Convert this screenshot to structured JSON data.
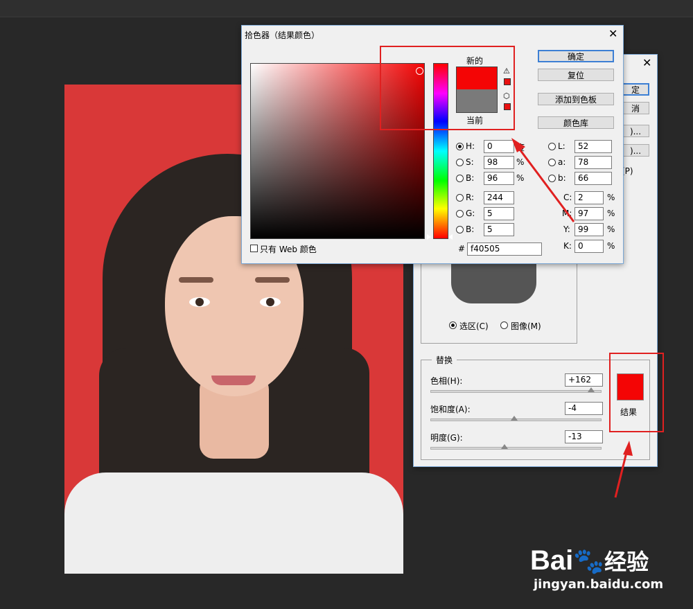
{
  "picker": {
    "title": "拾色器（结果颜色）",
    "new_label": "新的",
    "current_label": "当前",
    "buttons": {
      "ok": "确定",
      "reset": "复位",
      "add_swatch": "添加到色板",
      "libraries": "颜色库"
    },
    "hsb": {
      "h": {
        "label": "H:",
        "value": "0",
        "unit": "度"
      },
      "s": {
        "label": "S:",
        "value": "98",
        "unit": "%"
      },
      "b": {
        "label": "B:",
        "value": "96",
        "unit": "%"
      }
    },
    "rgb": {
      "r": {
        "label": "R:",
        "value": "244"
      },
      "g": {
        "label": "G:",
        "value": "5"
      },
      "b": {
        "label": "B:",
        "value": "5"
      }
    },
    "lab": {
      "l": {
        "label": "L:",
        "value": "52"
      },
      "a": {
        "label": "a:",
        "value": "78"
      },
      "b": {
        "label": "b:",
        "value": "66"
      }
    },
    "cmyk": {
      "c": {
        "label": "C:",
        "value": "2",
        "unit": "%"
      },
      "m": {
        "label": "M:",
        "value": "97",
        "unit": "%"
      },
      "y": {
        "label": "Y:",
        "value": "99",
        "unit": "%"
      },
      "k": {
        "label": "K:",
        "value": "0",
        "unit": "%"
      }
    },
    "hex_label": "#",
    "hex_value": "f40505",
    "web_only_label": "只有 Web 颜色"
  },
  "replace": {
    "ok_partial": "定",
    "cancel_partial": "消",
    "load_partial": ")...",
    "save_partial": ")...",
    "preview_partial": "(P)",
    "mode_selection": "选区(C)",
    "mode_image": "图像(M)",
    "group_label": "替换",
    "hue": {
      "label": "色相(H):",
      "value": "+162",
      "fraction": 0.94
    },
    "saturation": {
      "label": "饱和度(A):",
      "value": "-4",
      "fraction": 0.49
    },
    "lightness": {
      "label": "明度(G):",
      "value": "-13",
      "fraction": 0.435
    },
    "result_label": "结果"
  },
  "watermark": {
    "brand": "Bai",
    "brand2": "经验",
    "url": "jingyan.baidu.com"
  },
  "colors": {
    "new_color": "#f40505",
    "current_color": "#7a7a7a",
    "result_color": "#f40505",
    "highlight": "#e02020",
    "photo_bg": "#d93838"
  }
}
